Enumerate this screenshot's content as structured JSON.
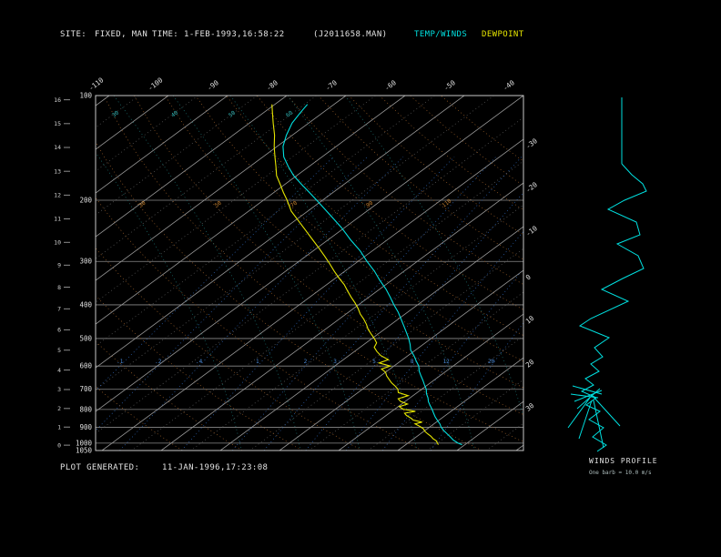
{
  "header": {
    "site_label": "SITE:",
    "site_value": "FIXED, MAN",
    "time_label": "TIME:",
    "time_value": "1-FEB-1993,16:58:22",
    "file_id": "(J2011658.MAN)",
    "series_temp_label": "TEMP/WINDS",
    "series_dew_label": "DEWPOINT"
  },
  "footer": {
    "generated_label": "PLOT GENERATED:",
    "generated_value": "11-JAN-1996,17:23:08"
  },
  "wind_panel": {
    "title": "WINDS PROFILE",
    "legend": "One barb = 10.0 m/s"
  },
  "colors": {
    "background": "#000000",
    "frame": "#c8c8c8",
    "grid": "#8a8a8a",
    "isotherm": "#989898",
    "isotherm_minor": "#5e5e5e",
    "temp": "#00e0e0",
    "dewpoint": "#e6e600",
    "adiabat": "#a0622a",
    "adiabat_label": "#c8822e",
    "mixratio": "#2e66b8",
    "mixratio_label": "#4a8ad8",
    "moist": "#1d7878",
    "moist_label": "#2fb4b4",
    "text": "#e0e0e0"
  },
  "chart_data": {
    "type": "line",
    "title": "",
    "diagram": "skew-t log-p sounding",
    "pressure_axis": {
      "scale": "log",
      "range": [
        100,
        1050
      ],
      "ticks": [
        100,
        200,
        300,
        400,
        500,
        600,
        700,
        800,
        900,
        1000,
        1050
      ]
    },
    "height_axis_km": [
      0,
      1,
      2,
      3,
      4,
      5,
      6,
      7,
      8,
      9,
      10,
      11,
      12,
      13,
      14,
      15,
      16
    ],
    "isotherm_step": 10,
    "isotherm_labels_top": [
      -110,
      -100,
      -90,
      -80,
      -70,
      -60,
      -50,
      -40
    ],
    "isotherm_labels_right": [
      -30,
      -20,
      -10,
      0,
      10,
      20,
      30
    ],
    "dry_adiabat_label_values": [
      30,
      50,
      70,
      90,
      110
    ],
    "dry_adiabat_label_pressure": 210,
    "mixing_ratio_lines": [
      {
        "value": 0.1,
        "label": ".1"
      },
      {
        "value": 0.2,
        "label": ".2"
      },
      {
        "value": 0.4,
        "label": ".4"
      },
      {
        "value": 1,
        "label": "1"
      },
      {
        "value": 2,
        "label": "2"
      },
      {
        "value": 3,
        "label": "3"
      },
      {
        "value": 5,
        "label": "5"
      },
      {
        "value": 8,
        "label": "8"
      },
      {
        "value": 12,
        "label": "12"
      },
      {
        "value": 20,
        "label": "20"
      }
    ],
    "mixing_ratio_label_pressure": 600,
    "moist_adiabat_labels": [
      {
        "value": 30,
        "x": 125
      },
      {
        "value": 40,
        "x": 190
      },
      {
        "value": 50,
        "x": 253
      },
      {
        "value": 60,
        "x": 316
      }
    ],
    "series": [
      {
        "name": "temp-trace",
        "label": "TEMP/WINDS",
        "color_key": "temp",
        "points": [
          [
            1010,
            29.5
          ],
          [
            1000,
            28.5
          ],
          [
            980,
            27.0
          ],
          [
            960,
            25.8
          ],
          [
            940,
            24.5
          ],
          [
            920,
            23.2
          ],
          [
            900,
            22.0
          ],
          [
            880,
            21.0
          ],
          [
            860,
            19.8
          ],
          [
            840,
            18.6
          ],
          [
            820,
            17.5
          ],
          [
            800,
            16.4
          ],
          [
            780,
            15.2
          ],
          [
            760,
            14.0
          ],
          [
            740,
            13.0
          ],
          [
            720,
            11.8
          ],
          [
            700,
            10.8
          ],
          [
            680,
            9.5
          ],
          [
            660,
            8.2
          ],
          [
            640,
            6.8
          ],
          [
            620,
            5.4
          ],
          [
            600,
            4.2
          ],
          [
            580,
            2.6
          ],
          [
            560,
            1.0
          ],
          [
            540,
            -0.8
          ],
          [
            520,
            -2.2
          ],
          [
            500,
            -3.8
          ],
          [
            480,
            -5.6
          ],
          [
            460,
            -7.5
          ],
          [
            440,
            -9.5
          ],
          [
            420,
            -11.6
          ],
          [
            400,
            -14.0
          ],
          [
            380,
            -16.4
          ],
          [
            360,
            -19.0
          ],
          [
            340,
            -22.0
          ],
          [
            320,
            -25.0
          ],
          [
            300,
            -28.5
          ],
          [
            280,
            -32.0
          ],
          [
            260,
            -36.2
          ],
          [
            240,
            -40.5
          ],
          [
            220,
            -45.5
          ],
          [
            200,
            -51.0
          ],
          [
            190,
            -54.0
          ],
          [
            180,
            -57.2
          ],
          [
            170,
            -60.5
          ],
          [
            160,
            -63.5
          ],
          [
            150,
            -66.5
          ],
          [
            140,
            -69.0
          ],
          [
            130,
            -71.0
          ],
          [
            120,
            -72.8
          ],
          [
            112,
            -73.8
          ],
          [
            106,
            -74.5
          ]
        ]
      },
      {
        "name": "dewpoint-trace",
        "label": "DEWPOINT",
        "color_key": "dewpoint",
        "points": [
          [
            1010,
            25.5
          ],
          [
            1000,
            25.0
          ],
          [
            985,
            24.3
          ],
          [
            970,
            23.2
          ],
          [
            955,
            22.3
          ],
          [
            940,
            21.2
          ],
          [
            925,
            20.2
          ],
          [
            910,
            19.4
          ],
          [
            895,
            18.2
          ],
          [
            880,
            16.8
          ],
          [
            870,
            17.6
          ],
          [
            858,
            15.6
          ],
          [
            845,
            14.6
          ],
          [
            832,
            13.4
          ],
          [
            820,
            12.6
          ],
          [
            810,
            14.0
          ],
          [
            798,
            11.4
          ],
          [
            785,
            10.2
          ],
          [
            772,
            11.0
          ],
          [
            758,
            9.2
          ],
          [
            745,
            8.2
          ],
          [
            730,
            9.2
          ],
          [
            715,
            6.8
          ],
          [
            700,
            6.0
          ],
          [
            685,
            4.8
          ],
          [
            670,
            3.4
          ],
          [
            655,
            2.2
          ],
          [
            640,
            1.0
          ],
          [
            625,
            0.0
          ],
          [
            612,
            -1.4
          ],
          [
            600,
            -0.6
          ],
          [
            588,
            -3.2
          ],
          [
            575,
            -2.4
          ],
          [
            560,
            -4.6
          ],
          [
            545,
            -6.2
          ],
          [
            530,
            -7.6
          ],
          [
            515,
            -8.2
          ],
          [
            500,
            -9.6
          ],
          [
            485,
            -11.2
          ],
          [
            470,
            -12.8
          ],
          [
            455,
            -14.2
          ],
          [
            440,
            -15.8
          ],
          [
            425,
            -17.6
          ],
          [
            410,
            -19.2
          ],
          [
            395,
            -21.0
          ],
          [
            380,
            -23.0
          ],
          [
            365,
            -25.0
          ],
          [
            350,
            -27.0
          ],
          [
            335,
            -29.4
          ],
          [
            320,
            -31.8
          ],
          [
            305,
            -34.2
          ],
          [
            290,
            -36.8
          ],
          [
            275,
            -39.6
          ],
          [
            260,
            -42.6
          ],
          [
            245,
            -45.8
          ],
          [
            230,
            -49.2
          ],
          [
            215,
            -52.8
          ],
          [
            200,
            -56.0
          ],
          [
            190,
            -58.4
          ],
          [
            180,
            -60.8
          ],
          [
            170,
            -63.4
          ],
          [
            160,
            -65.6
          ],
          [
            150,
            -68.0
          ],
          [
            140,
            -70.5
          ],
          [
            130,
            -73.0
          ],
          [
            120,
            -76.0
          ],
          [
            112,
            -78.5
          ],
          [
            106,
            -80.5
          ]
        ]
      }
    ],
    "wind_profile": {
      "barb_scale": "10.0 m/s per barb",
      "staff": [
        [
          683,
          107
        ],
        [
          683,
          180
        ]
      ],
      "trace": [
        [
          683,
          180
        ],
        [
          694,
          192
        ],
        [
          706,
          202
        ],
        [
          710,
          210
        ],
        [
          686,
          220
        ],
        [
          668,
          230
        ],
        [
          699,
          244
        ],
        [
          703,
          258
        ],
        [
          678,
          268
        ],
        [
          701,
          281
        ],
        [
          707,
          295
        ],
        [
          684,
          306
        ],
        [
          661,
          318
        ],
        [
          690,
          331
        ],
        [
          649,
          350
        ],
        [
          637,
          358
        ],
        [
          669,
          371
        ],
        [
          653,
          382
        ],
        [
          662,
          392
        ],
        [
          649,
          400
        ],
        [
          658,
          408
        ],
        [
          643,
          416
        ],
        [
          652,
          423
        ],
        [
          639,
          430
        ],
        [
          655,
          437
        ],
        [
          644,
          445
        ],
        [
          659,
          452
        ],
        [
          647,
          461
        ],
        [
          663,
          470
        ],
        [
          651,
          480
        ],
        [
          666,
          489
        ],
        [
          656,
          496
        ]
      ],
      "barbs": [
        [
          [
            629,
            424
          ],
          [
            661,
            433
          ]
        ],
        [
          [
            631,
            441
          ],
          [
            661,
            429
          ]
        ],
        [
          [
            634,
            449
          ],
          [
            659,
            427
          ]
        ],
        [
          [
            627,
            433
          ],
          [
            657,
            437
          ]
        ],
        [
          [
            648,
            437
          ],
          [
            624,
            470
          ]
        ],
        [
          [
            650,
            440
          ],
          [
            636,
            482
          ]
        ],
        [
          [
            652,
            440
          ],
          [
            663,
            492
          ]
        ],
        [
          [
            650,
            434
          ],
          [
            681,
            468
          ]
        ]
      ]
    }
  }
}
